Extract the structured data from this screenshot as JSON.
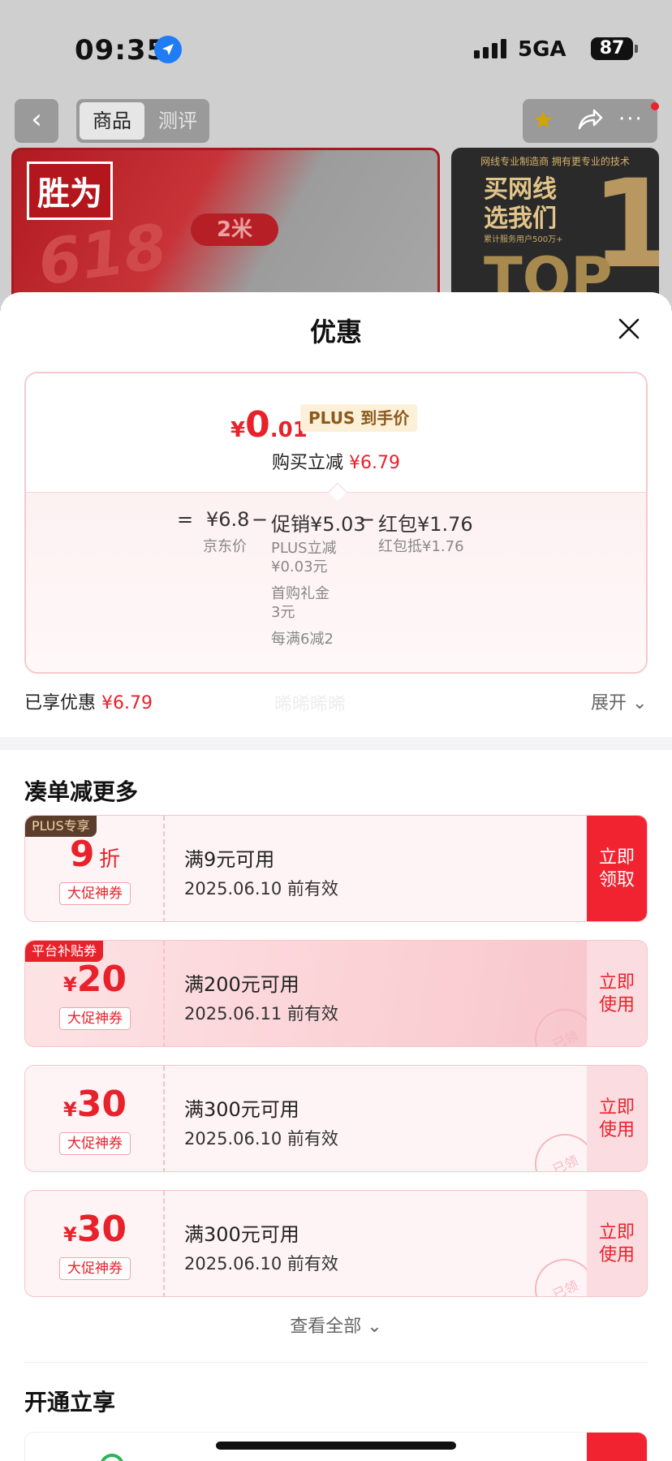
{
  "status_bar": {
    "time": "09:35",
    "network": "5GA",
    "battery": "87"
  },
  "nav": {
    "back_icon": "chevron-left-icon",
    "tabs": [
      {
        "label": "商品",
        "active": true
      },
      {
        "label": "测评",
        "active": false
      }
    ]
  },
  "banner": {
    "brand": "胜为",
    "sale_text": "618",
    "chip": "2米"
  },
  "banner2": {
    "line1": "网线专业制造商 拥有更专业的技术",
    "line2a": "买网线",
    "line2b": "选我们",
    "line3": "累计服务用户500万+",
    "top": "TOP",
    "one": "1"
  },
  "sheet": {
    "title": "优惠",
    "price": {
      "symbol": "¥",
      "int": "0",
      "dec": ".01",
      "tag": "PLUS 到手价",
      "instant_label": "购买立减",
      "instant_value": "¥6.79"
    },
    "breakdown": {
      "eq": "=",
      "jd_price": "¥6.8",
      "jd_label": "京东价",
      "minus": "−",
      "promo": "促销¥5.03",
      "promo_items": [
        "PLUS立减",
        "¥0.03元",
        "首购礼金",
        "3元",
        "每满6减2"
      ],
      "redpacket": "红包¥1.76",
      "redpacket_label": "红包抵¥1.76"
    },
    "enjoyed_label": "已享优惠",
    "enjoyed_value": "¥6.79",
    "watermark": "晞晞晞晞",
    "expand": "展开"
  },
  "more_section": {
    "title": "凑单减更多"
  },
  "coupons": [
    {
      "tag": "PLUS专享",
      "tag_type": "plus",
      "symbol": "",
      "amount": "9",
      "unit": "折",
      "sub": "大促神券",
      "title": "满9元可用",
      "date": "2025.06.10 前有效",
      "btn1": "立即",
      "btn2": "领取",
      "btn_red": true,
      "stamp": ""
    },
    {
      "tag": "平台补贴券",
      "tag_type": "plat",
      "symbol": "¥",
      "amount": "20",
      "unit": "",
      "sub": "大促神券",
      "title": "满200元可用",
      "date": "2025.06.11 前有效",
      "btn1": "立即",
      "btn2": "使用",
      "btn_red": false,
      "stamp": "已领"
    },
    {
      "tag": "",
      "tag_type": "",
      "symbol": "¥",
      "amount": "30",
      "unit": "",
      "sub": "大促神券",
      "title": "满300元可用",
      "date": "2025.06.10 前有效",
      "btn1": "立即",
      "btn2": "使用",
      "btn_red": false,
      "stamp": "已领"
    },
    {
      "tag": "",
      "tag_type": "",
      "symbol": "¥",
      "amount": "30",
      "unit": "",
      "sub": "大促神券",
      "title": "满300元可用",
      "date": "2025.06.10 前有效",
      "btn1": "立即",
      "btn2": "使用",
      "btn_red": false,
      "stamp": "已领"
    }
  ],
  "view_all": "查看全部",
  "open_section": {
    "title": "开通立享"
  },
  "colors": {
    "accent": "#e8222b",
    "plus_gold": "#8a5a1c"
  }
}
